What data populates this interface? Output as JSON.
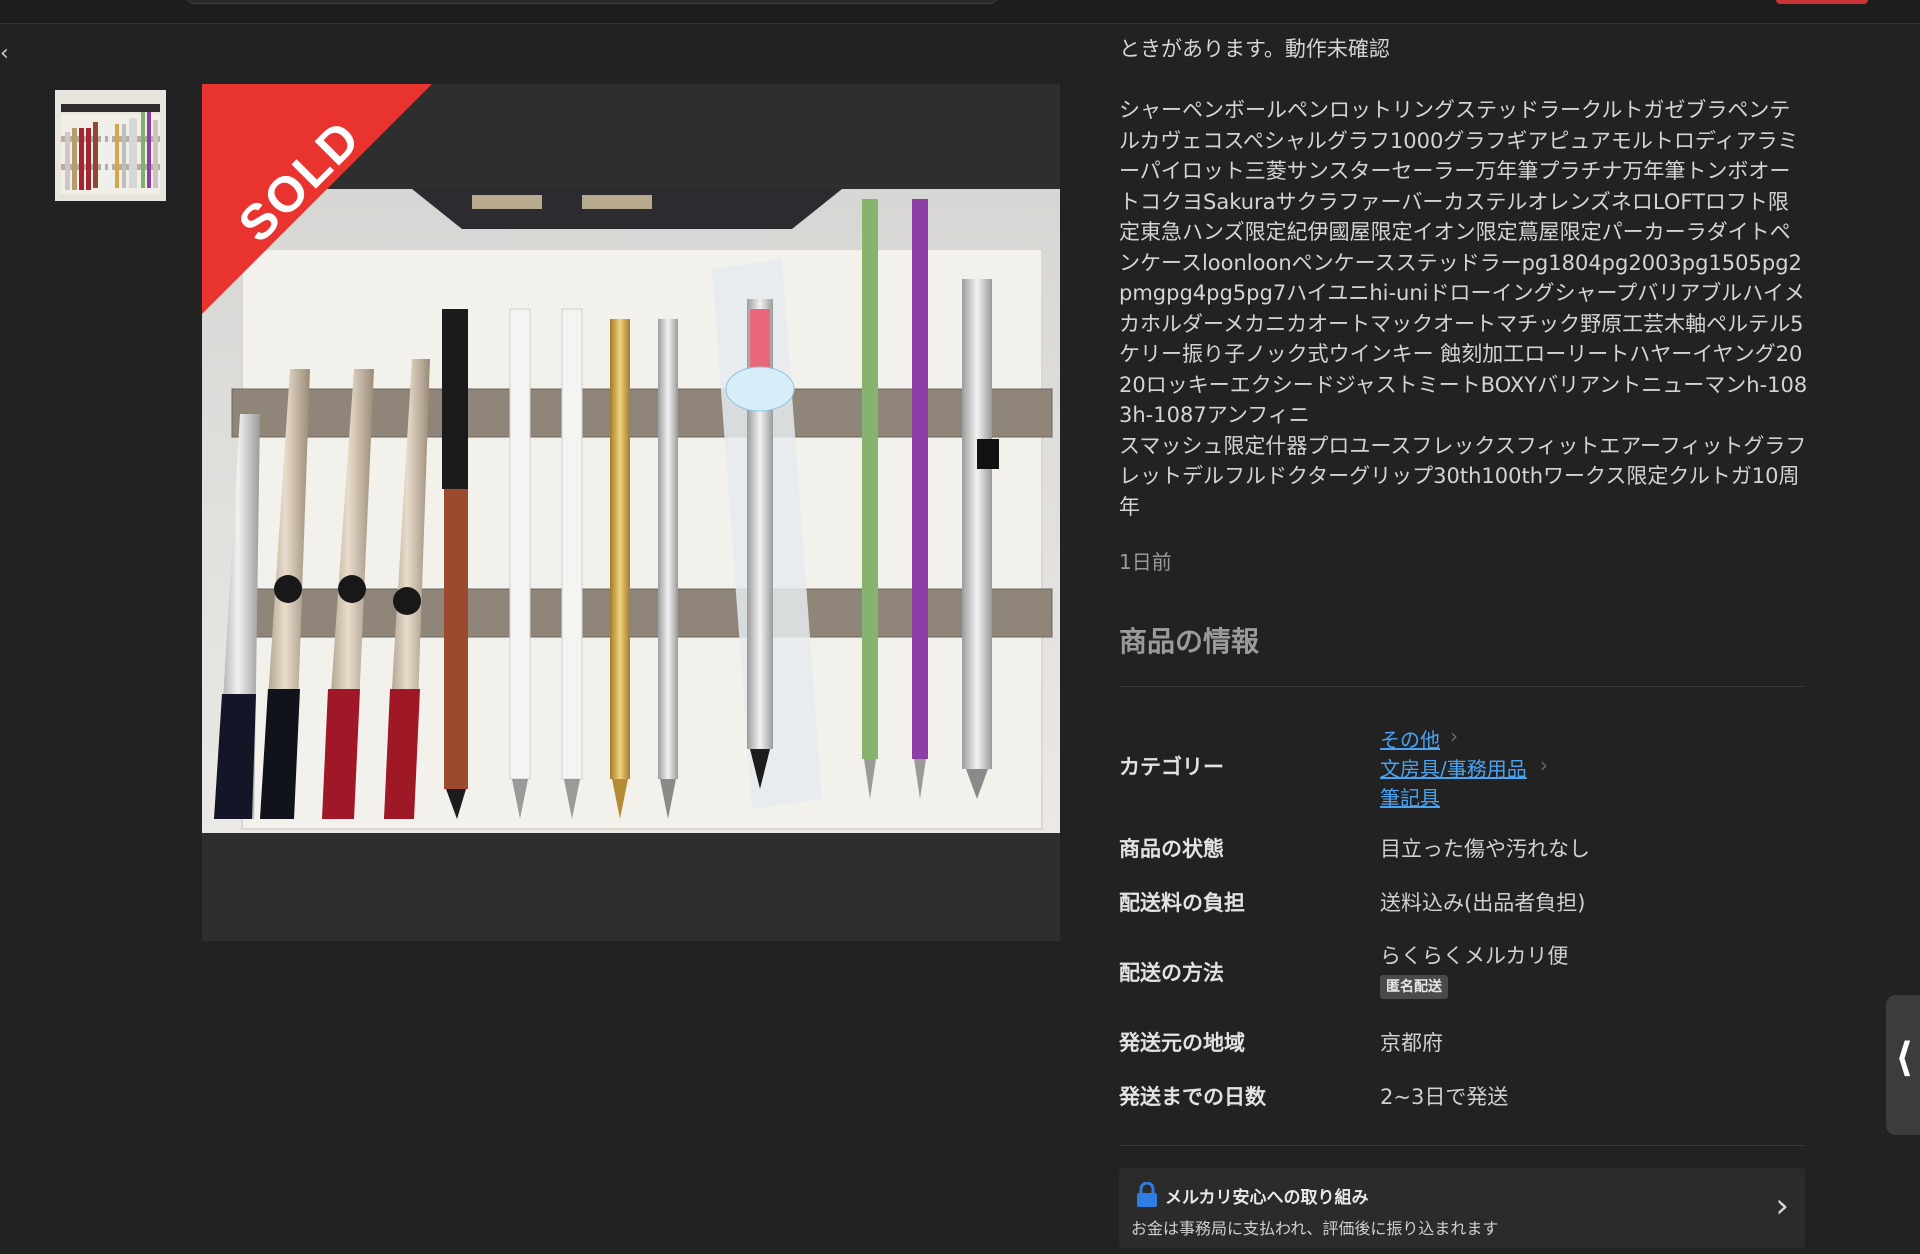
{
  "description": {
    "top_line": "ときがあります。動作未確認",
    "body": "シャーペンボールペンロットリングステッドラークルトガゼブラペンテルカヴェコスペシャルグラフ1000グラフギアピュアモルトロディアラミーパイロット三菱サンスターセーラー万年筆プラチナ万年筆トンボオートコクヨSakuraサクラファーバーカステルオレンズネロLOFTロフト限定東急ハンズ限定紀伊國屋限定イオン限定蔦屋限定パーカーラダイトペンケースloonloonペンケースステッドラーpg1804pg2003pg1505pg2pmgpg4pg5pg7ハイユニhi-uniドローイングシャープバリアブルハイメカホルダーメカニカオートマックオートマチック野原工芸木軸ペルテル5ケリー振り子ノック式ウインキー 蝕刻加工ローリートハヤーイヤング2020ロッキーエクシードジャストミートBOXYバリアントニューマンh-1083h-1087アンフィニ\nスマッシュ限定什器プロユースフレックスフィットエアーフィットグラフレットデルフルドクターグリップ30th100thワークス限定クルトガ10周年"
  },
  "time_ago": "1日前",
  "product_info": {
    "title": "商品の情報",
    "category_label": "カテゴリー",
    "categories": [
      "その他",
      "文房具/事務用品",
      "筆記具"
    ],
    "condition_label": "商品の状態",
    "condition_value": "目立った傷や汚れなし",
    "shipping_fee_label": "配送料の負担",
    "shipping_fee_value": "送料込み(出品者負担)",
    "shipping_method_label": "配送の方法",
    "shipping_method_value": "らくらくメルカリ便",
    "anonymous_badge": "匿名配送",
    "origin_label": "発送元の地域",
    "origin_value": "京都府",
    "days_label": "発送までの日数",
    "days_value": "2~3日で発送"
  },
  "sold_label": "SOLD",
  "anshin": {
    "title": "メルカリ安心への取り組み",
    "subtitle": "お金は事務局に支払われ、評価後に振り込まれます"
  },
  "colors": {
    "background": "#222222",
    "sold_ribbon": "#e8332e",
    "link": "#4aa3ee",
    "lock": "#2f7de1"
  }
}
